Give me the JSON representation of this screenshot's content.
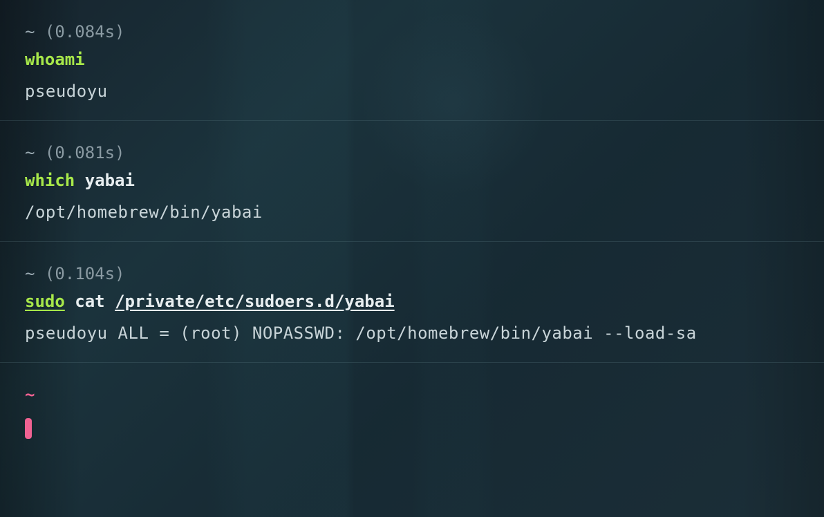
{
  "blocks": [
    {
      "prompt": "~",
      "timing": "(0.084s)",
      "command_parts": [
        {
          "text": "whoami",
          "cls": "cmd-green"
        }
      ],
      "output": "pseudoyu"
    },
    {
      "prompt": "~",
      "timing": "(0.081s)",
      "command_parts": [
        {
          "text": "which",
          "cls": "cmd-green"
        },
        {
          "text": " ",
          "cls": "cmd-white"
        },
        {
          "text": "yabai",
          "cls": "cmd-white"
        }
      ],
      "output": "/opt/homebrew/bin/yabai"
    },
    {
      "prompt": "~",
      "timing": "(0.104s)",
      "command_parts": [
        {
          "text": "sudo",
          "cls": "cmd-green cmd-underline"
        },
        {
          "text": " ",
          "cls": "cmd-white"
        },
        {
          "text": "cat",
          "cls": "cmd-white"
        },
        {
          "text": " ",
          "cls": "cmd-white"
        },
        {
          "text": "/private/etc/sudoers.d/yabai",
          "cls": "cmd-white cmd-underline"
        }
      ],
      "output": "pseudoyu ALL = (root) NOPASSWD: /opt/homebrew/bin/yabai --load-sa"
    }
  ],
  "active_prompt": "~"
}
